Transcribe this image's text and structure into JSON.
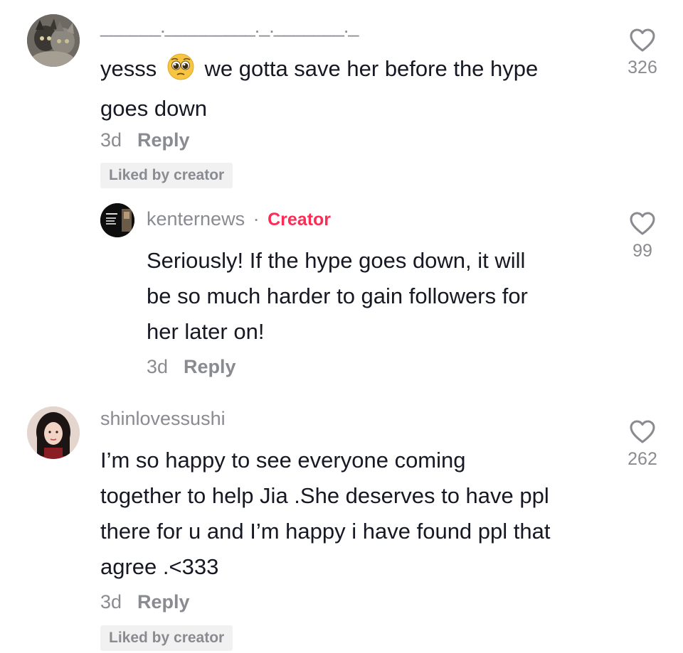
{
  "comments": [
    {
      "username": "______._________._._______._",
      "text": "yesss 🥺 we gotta save her before the hype goes down",
      "text_parts": [
        "yesss",
        "we gotta save her before the hype",
        "goes down"
      ],
      "emoji_icon": "pleading-face-emoji",
      "time": "3d",
      "reply_label": "Reply",
      "badge": "Liked by creator",
      "likes": "326",
      "replies": [
        {
          "username": "kenternews",
          "separator": "·",
          "creator_label": "Creator",
          "avatar_caption": "Follow for all the latest news!",
          "text_lines": [
            "Seriously! If the hype goes down, it will",
            "be so much harder to gain followers for",
            "her later on!"
          ],
          "time": "3d",
          "reply_label": "Reply",
          "likes": "99"
        }
      ]
    },
    {
      "username": "shinlovessushi",
      "text_lines": [
        "I’m so happy to see everyone coming",
        "together to help Jia .She deserves to have ppl",
        "there for u and I’m happy i have found ppl that",
        "agree .<333"
      ],
      "time": "3d",
      "reply_label": "Reply",
      "badge": "Liked by creator",
      "likes": "262"
    }
  ],
  "colors": {
    "text": "#161823",
    "secondary": "#8a8b91",
    "creator": "#fe2c55",
    "badge_bg": "#f1f1f2"
  },
  "icons": {
    "like": "heart-outline-icon"
  }
}
